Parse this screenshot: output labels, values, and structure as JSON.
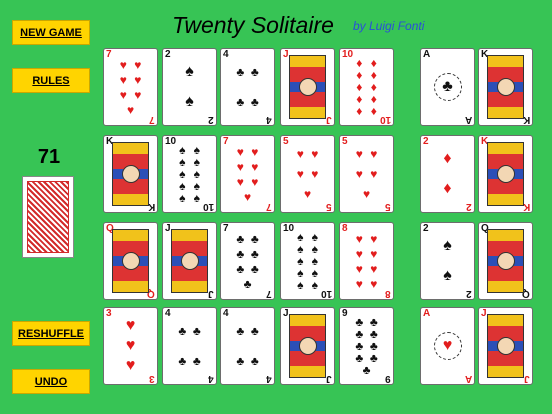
{
  "buttons": {
    "new_game": "NEW GAME",
    "rules": "RULES",
    "reshuffle": "RESHUFFLE",
    "undo": "UNDO"
  },
  "header": {
    "title": "Twenty Solitaire",
    "byline": "by Luigi Fonti"
  },
  "stock": {
    "count": "71"
  },
  "tableau": [
    [
      {
        "rank": "7",
        "suit": "♥",
        "color": "red"
      },
      {
        "rank": "2",
        "suit": "♠",
        "color": "black"
      },
      {
        "rank": "4",
        "suit": "♣",
        "color": "black"
      },
      {
        "rank": "J",
        "suit": "♦",
        "color": "red"
      },
      {
        "rank": "10",
        "suit": "♦",
        "color": "red"
      }
    ],
    [
      {
        "rank": "K",
        "suit": "♠",
        "color": "black"
      },
      {
        "rank": "10",
        "suit": "♠",
        "color": "black"
      },
      {
        "rank": "7",
        "suit": "♥",
        "color": "red"
      },
      {
        "rank": "5",
        "suit": "♥",
        "color": "red"
      },
      {
        "rank": "5",
        "suit": "♥",
        "color": "red"
      }
    ],
    [
      {
        "rank": "Q",
        "suit": "♥",
        "color": "red"
      },
      {
        "rank": "J",
        "suit": "♠",
        "color": "black"
      },
      {
        "rank": "7",
        "suit": "♣",
        "color": "black"
      },
      {
        "rank": "10",
        "suit": "♠",
        "color": "black"
      },
      {
        "rank": "8",
        "suit": "♥",
        "color": "red"
      }
    ],
    [
      {
        "rank": "3",
        "suit": "♥",
        "color": "red"
      },
      {
        "rank": "4",
        "suit": "♣",
        "color": "black"
      },
      {
        "rank": "4",
        "suit": "♣",
        "color": "black"
      },
      {
        "rank": "J",
        "suit": "♣",
        "color": "black"
      },
      {
        "rank": "9",
        "suit": "♣",
        "color": "black"
      }
    ]
  ],
  "foundations": [
    [
      {
        "rank": "A",
        "suit": "♣",
        "color": "black"
      },
      {
        "rank": "K",
        "suit": "♣",
        "color": "black"
      }
    ],
    [
      {
        "rank": "2",
        "suit": "♦",
        "color": "red"
      },
      {
        "rank": "K",
        "suit": "♥",
        "color": "red"
      }
    ],
    [
      {
        "rank": "2",
        "suit": "♠",
        "color": "black"
      },
      {
        "rank": "Q",
        "suit": "♠",
        "color": "black"
      }
    ],
    [
      {
        "rank": "A",
        "suit": "♥",
        "color": "red"
      },
      {
        "rank": "J",
        "suit": "♥",
        "color": "red"
      }
    ]
  ]
}
